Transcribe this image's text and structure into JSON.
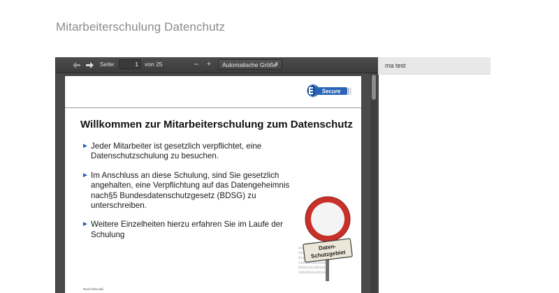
{
  "page": {
    "title": "Mitarbeiterschulung Datenchutz"
  },
  "viewer": {
    "toolbar": {
      "prev_icon": "arrow-left-icon",
      "next_icon": "arrow-right-icon",
      "page_label": "Seite:",
      "page_value": "1",
      "page_total": "von 25",
      "zoom_out": "−",
      "zoom_in": "+",
      "zoom_select": "Automatische Größe"
    },
    "slide": {
      "logo_text": "Secure",
      "heading": "Willkommen zur Mitarbeiterschulung zum Datenschutz",
      "bullets": [
        "Jeder Mitarbeiter ist gesetzlich verpflichtet, eine Datenschutzschulung zu besuchen.",
        "Im Anschluss an diese Schulung, sind Sie gesetzlich angehalten, eine Verpflichtung auf das Datengeheimnis nach§5 Bundesdatenschutzgesetz (BDSG) zu unterschreiben.",
        "Weitere Einzelheiten hierzu erfahren Sie im Laufe der Schulung"
      ],
      "sign_line1": "Daten-",
      "sign_line2": "Schutzgebiet",
      "footer": "René Eifrenaß"
    }
  },
  "right_pane": {
    "label": "ma test"
  },
  "colors": {
    "accent": "#2a64b8",
    "toolbar": "#444444",
    "sign_red": "#c8302a"
  }
}
